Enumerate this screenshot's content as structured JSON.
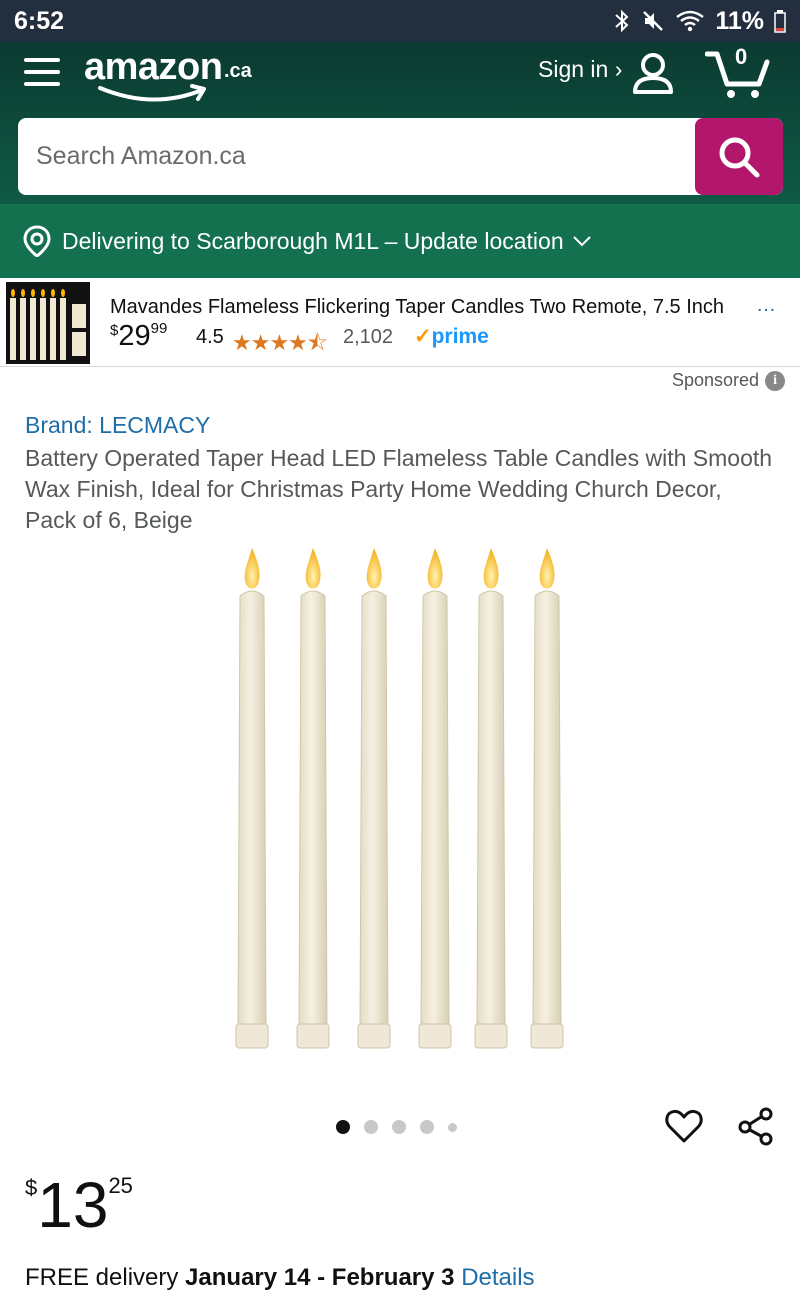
{
  "status_bar": {
    "time": "6:52",
    "battery": "11%",
    "icons": [
      "bluetooth-icon",
      "mute-icon",
      "wifi-icon",
      "battery-icon"
    ]
  },
  "header": {
    "logo_word": "amazon",
    "logo_tld": ".ca",
    "sign_in_label": "Sign in ›",
    "cart_count": "0"
  },
  "search": {
    "placeholder": "Search Amazon.ca",
    "value": ""
  },
  "location": {
    "text": "Delivering to Scarborough M1L – Update location"
  },
  "sponsored_ad": {
    "title": "Mavandes Flameless Flickering Taper Candles Two Remote, 7.5 Inch",
    "ellipsis": "…",
    "price_symbol": "$",
    "price_whole": "29",
    "price_fraction": "99",
    "rating": "4.5",
    "stars": "★★★★⯪",
    "review_count": "2,102",
    "prime_check": "✓",
    "prime_label": "prime",
    "sponsored_label": "Sponsored"
  },
  "product": {
    "brand": "Brand: LECMACY",
    "title": "Battery Operated Taper Head LED Flameless Table Candles with Smooth Wax Finish, Ideal for Christmas Party Home Wedding Church Decor, Pack of 6, Beige",
    "image_count": 5,
    "current_image": 1,
    "price_symbol": "$",
    "price_whole": "13",
    "price_fraction": "25"
  },
  "delivery": {
    "prefix": "FREE delivery ",
    "dates": "January 14 - February 3",
    "link": "Details"
  },
  "colors": {
    "header_dark": "#0b3a31",
    "location_bar": "#13714f",
    "search_button": "#b3176b",
    "link_blue": "#1f6ea8",
    "star_orange": "#de7921",
    "prime_blue": "#1a98ff"
  }
}
